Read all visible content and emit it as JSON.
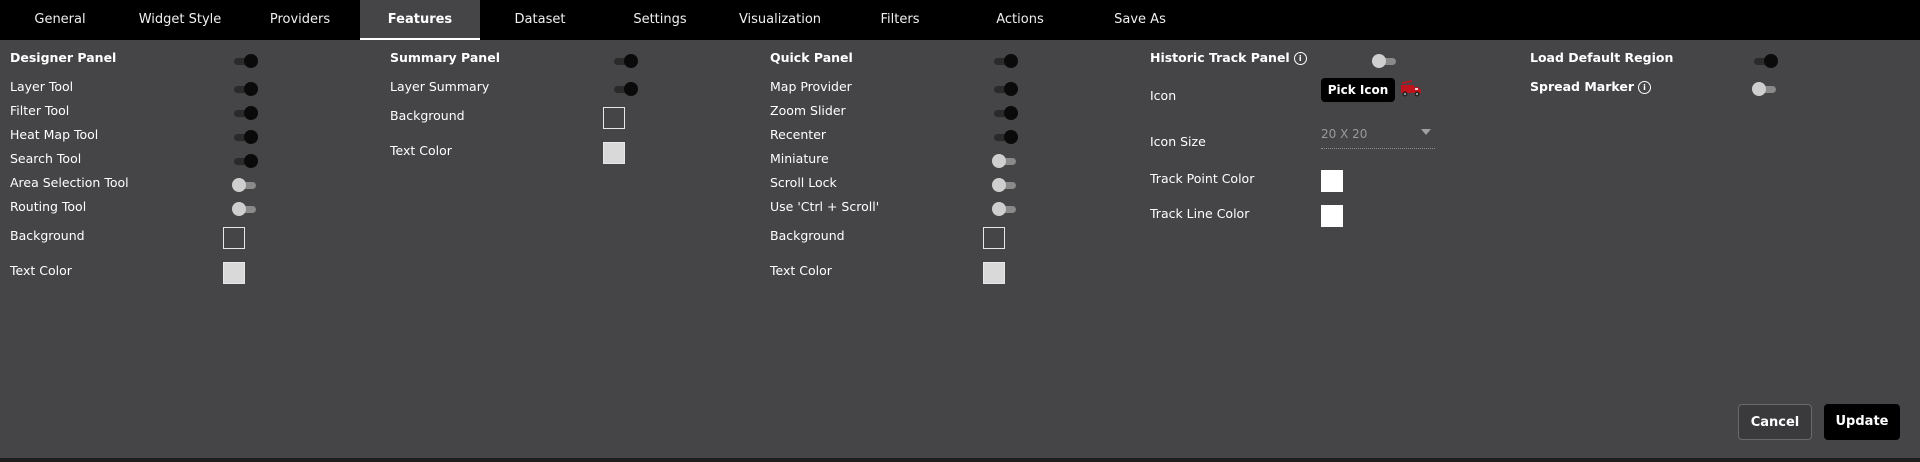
{
  "tabs": [
    {
      "label": "General",
      "active": false
    },
    {
      "label": "Widget Style",
      "active": false
    },
    {
      "label": "Providers",
      "active": false
    },
    {
      "label": "Features",
      "active": true
    },
    {
      "label": "Dataset",
      "active": false
    },
    {
      "label": "Settings",
      "active": false
    },
    {
      "label": "Visualization",
      "active": false
    },
    {
      "label": "Filters",
      "active": false
    },
    {
      "label": "Actions",
      "active": false
    },
    {
      "label": "Save As",
      "active": false
    }
  ],
  "designer": {
    "title": "Designer Panel",
    "title_on": true,
    "items": [
      {
        "label": "Layer Tool",
        "on": true
      },
      {
        "label": "Filter Tool",
        "on": true
      },
      {
        "label": "Heat Map Tool",
        "on": true
      },
      {
        "label": "Search Tool",
        "on": true
      },
      {
        "label": "Area Selection Tool",
        "on": false
      },
      {
        "label": "Routing Tool",
        "on": false
      }
    ],
    "background_label": "Background",
    "text_color_label": "Text Color"
  },
  "summary": {
    "title": "Summary Panel",
    "title_on": true,
    "items": [
      {
        "label": "Layer Summary",
        "on": true
      }
    ],
    "background_label": "Background",
    "text_color_label": "Text Color"
  },
  "quick": {
    "title": "Quick Panel",
    "title_on": true,
    "items": [
      {
        "label": "Map Provider",
        "on": true
      },
      {
        "label": "Zoom Slider",
        "on": true
      },
      {
        "label": "Recenter",
        "on": true
      },
      {
        "label": "Miniature",
        "on": false
      },
      {
        "label": "Scroll Lock",
        "on": false
      },
      {
        "label": "Use 'Ctrl + Scroll'",
        "on": false
      }
    ],
    "background_label": "Background",
    "text_color_label": "Text Color"
  },
  "historic": {
    "title": "Historic Track Panel",
    "title_on": false,
    "icon_label": "Icon",
    "pick_icon_label": "Pick Icon",
    "icon_name": "fire-truck-icon",
    "icon_size_label": "Icon Size",
    "icon_size_value": "20 X 20",
    "track_point_color_label": "Track Point Color",
    "track_line_color_label": "Track Line Color"
  },
  "region": {
    "load_default_label": "Load Default Region",
    "load_default_on": true,
    "spread_marker_label": "Spread Marker",
    "spread_marker_on": false
  },
  "actions": {
    "cancel_label": "Cancel",
    "update_label": "Update"
  },
  "colors": {
    "page_bg": "#454447",
    "tabbar_bg": "#000000",
    "truck_red": "#c0141c"
  }
}
